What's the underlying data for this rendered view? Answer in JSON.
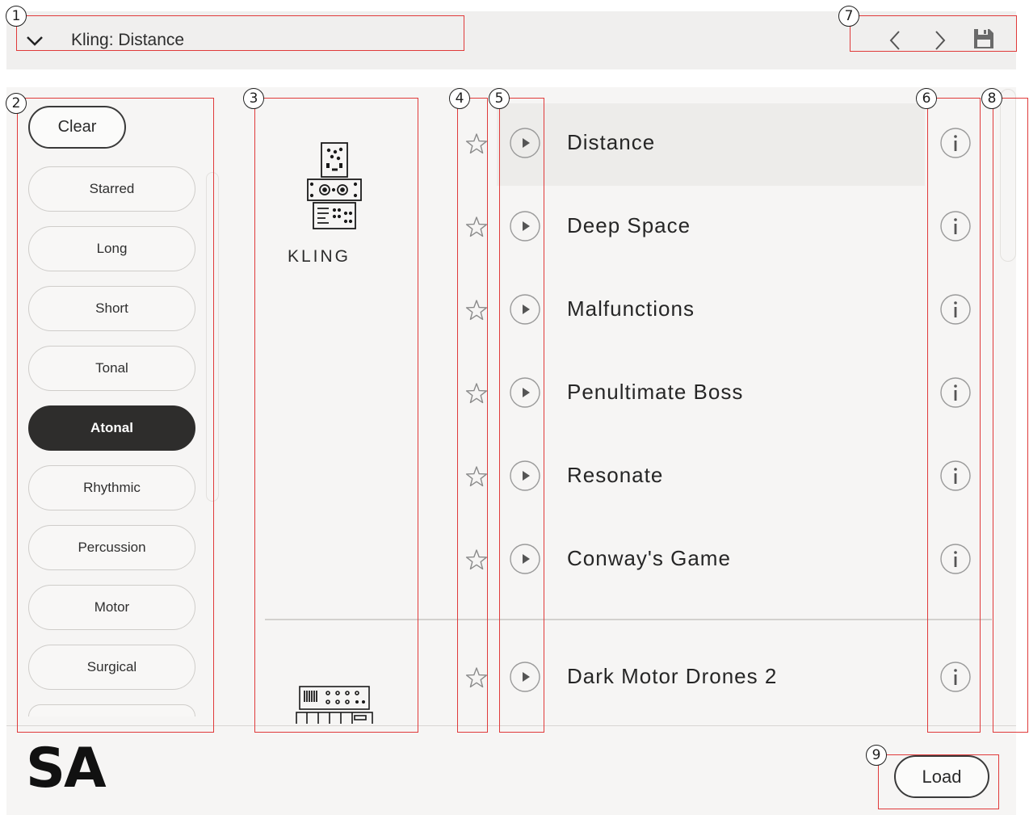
{
  "header": {
    "preset_title": "Kling: Distance",
    "dropdown_icon": "chevron-down-icon",
    "prev_icon": "chevron-left-icon",
    "next_icon": "chevron-right-icon",
    "save_icon": "floppy-disk-icon"
  },
  "tags": {
    "clear_label": "Clear",
    "items": [
      {
        "label": "Starred",
        "active": false
      },
      {
        "label": "Long",
        "active": false
      },
      {
        "label": "Short",
        "active": false
      },
      {
        "label": "Tonal",
        "active": false
      },
      {
        "label": "Atonal",
        "active": true
      },
      {
        "label": "Rhythmic",
        "active": false
      },
      {
        "label": "Percussion",
        "active": false
      },
      {
        "label": "Motor",
        "active": false
      },
      {
        "label": "Surgical",
        "active": false
      }
    ]
  },
  "instruments": {
    "primary_name": "KLING"
  },
  "presets": {
    "selected": "Distance",
    "items": [
      {
        "name": "Distance"
      },
      {
        "name": "Deep Space"
      },
      {
        "name": "Malfunctions"
      },
      {
        "name": "Penultimate Boss"
      },
      {
        "name": "Resonate"
      },
      {
        "name": "Conway's Game"
      },
      {
        "name": "Dark Motor Drones 2"
      }
    ],
    "star_icon": "star-outline-icon",
    "play_icon": "play-icon",
    "info_icon": "info-icon"
  },
  "footer": {
    "logo": "SA",
    "load_label": "Load"
  },
  "annotations": [
    "1",
    "2",
    "3",
    "4",
    "5",
    "6",
    "7",
    "8",
    "9"
  ]
}
